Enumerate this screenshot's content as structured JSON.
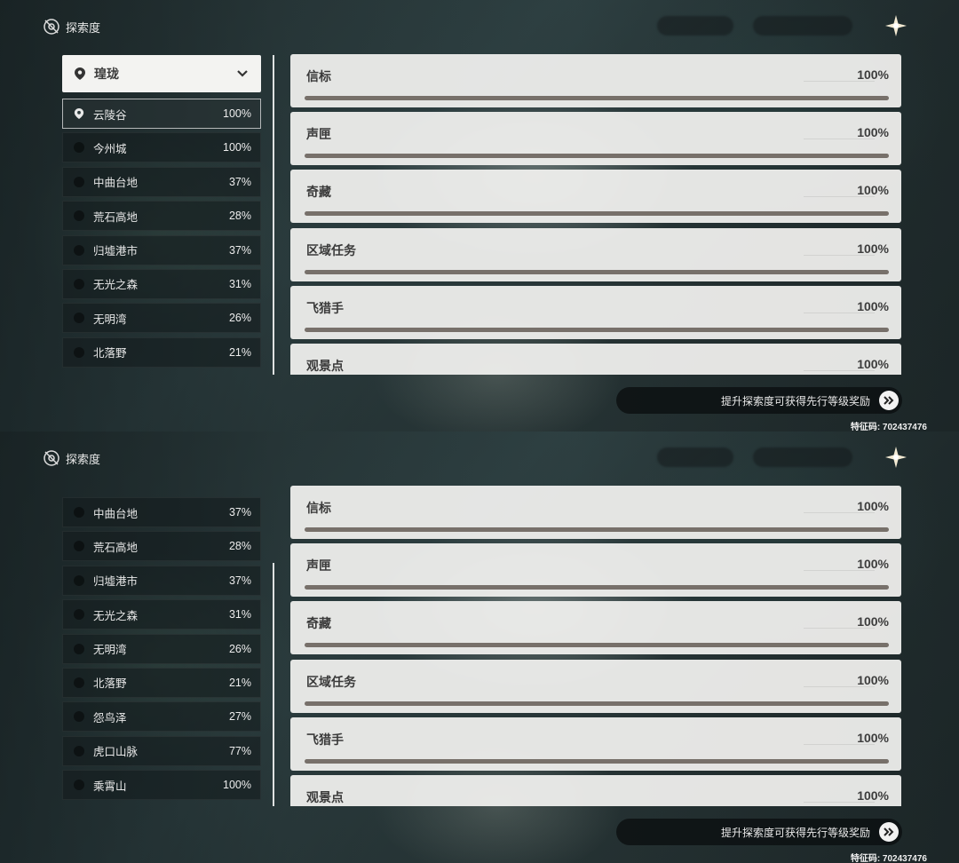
{
  "header": {
    "title": "探索度"
  },
  "top_panel": {
    "region_select": "瑝珑",
    "regions": [
      {
        "name": "云陵谷",
        "percent": "100%",
        "selected": true
      },
      {
        "name": "今州城",
        "percent": "100%"
      },
      {
        "name": "中曲台地",
        "percent": "37%"
      },
      {
        "name": "荒石高地",
        "percent": "28%"
      },
      {
        "name": "归墟港市",
        "percent": "37%"
      },
      {
        "name": "无光之森",
        "percent": "31%"
      },
      {
        "name": "无明湾",
        "percent": "26%"
      },
      {
        "name": "北落野",
        "percent": "21%"
      }
    ],
    "categories": [
      {
        "name": "信标",
        "percent": "100%",
        "progress": 1.0
      },
      {
        "name": "声匣",
        "percent": "100%",
        "progress": 1.0
      },
      {
        "name": "奇藏",
        "percent": "100%",
        "progress": 1.0
      },
      {
        "name": "区域任务",
        "percent": "100%",
        "progress": 1.0
      },
      {
        "name": "飞猎手",
        "percent": "100%",
        "progress": 1.0
      },
      {
        "name": "观景点",
        "percent": "100%",
        "progress": 1.0
      }
    ],
    "reward_text": "提升探索度可获得先行等级奖励",
    "uid": "特征码: 702437476"
  },
  "bottom_panel": {
    "regions": [
      {
        "name": "中曲台地",
        "percent": "37%"
      },
      {
        "name": "荒石高地",
        "percent": "28%"
      },
      {
        "name": "归墟港市",
        "percent": "37%"
      },
      {
        "name": "无光之森",
        "percent": "31%"
      },
      {
        "name": "无明湾",
        "percent": "26%"
      },
      {
        "name": "北落野",
        "percent": "21%"
      },
      {
        "name": "怨鸟泽",
        "percent": "27%"
      },
      {
        "name": "虎口山脉",
        "percent": "77%"
      },
      {
        "name": "乘霄山",
        "percent": "100%"
      }
    ],
    "categories": [
      {
        "name": "信标",
        "percent": "100%",
        "progress": 1.0
      },
      {
        "name": "声匣",
        "percent": "100%",
        "progress": 1.0
      },
      {
        "name": "奇藏",
        "percent": "100%",
        "progress": 1.0
      },
      {
        "name": "区域任务",
        "percent": "100%",
        "progress": 1.0
      },
      {
        "name": "飞猎手",
        "percent": "100%",
        "progress": 1.0
      },
      {
        "name": "观景点",
        "percent": "100%",
        "progress": 1.0
      }
    ],
    "reward_text": "提升探索度可获得先行等级奖励",
    "uid": "特征码: 702437476"
  },
  "colors": {
    "card_bg": "#f0f0ee",
    "bar_fill": "#77706a",
    "accent": "#ffffff"
  },
  "icons": {
    "header": "eye-slash-icon",
    "close": "star-close-icon",
    "reward": "double-chevron-right-icon",
    "location": "location-pin-icon"
  }
}
